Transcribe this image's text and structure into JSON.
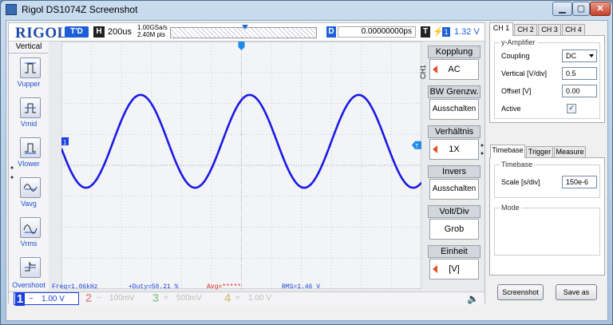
{
  "window": {
    "title": "Rigol DS1074Z Screenshot",
    "min_icon": "minimize-icon",
    "max_icon": "maximize-icon",
    "close_icon": "close-icon",
    "close_glyph": "✕"
  },
  "topbar": {
    "logo": "RIGOL",
    "mode_badge": "T'D",
    "timebase_badge": "H",
    "timebase": "200us",
    "sample_rate": "1.00GSa/s",
    "mem_depth": "2.40M pts",
    "delay_badge": "D",
    "delay": "0.00000000ps",
    "trigger_badge": "T",
    "trigger_slope_glyph": "⚡",
    "trigger_channel": "1",
    "trigger_level": "1.32 V"
  },
  "vertical": {
    "title": "Vertical",
    "buttons": [
      {
        "label": "Vupper",
        "icon": "vupper-icon"
      },
      {
        "label": "Vmid",
        "icon": "vmid-icon"
      },
      {
        "label": "Vlower",
        "icon": "vlower-icon"
      },
      {
        "label": "Vavg",
        "icon": "vavg-icon"
      },
      {
        "label": "Vrms",
        "icon": "vrms-icon"
      },
      {
        "label": "Overshoot",
        "icon": "overshoot-icon"
      }
    ]
  },
  "waveform": {
    "channel_color": "#1a1ae6",
    "cycles": 3.3,
    "amplitude_div": 1.5,
    "marker_ch": "1",
    "trigger_marker": "T"
  },
  "measurements": {
    "freq": "Freq=1.06kHz",
    "duty": "+Duty=50.21 %",
    "avg": "Avg=*****",
    "rms": "RMS=1.46 V"
  },
  "menu": {
    "channel_label": "CH1",
    "items": [
      {
        "title": "Kopplung",
        "value": "AC",
        "arrow": true
      },
      {
        "title": "BW Grenzw.",
        "value": "Ausschalten",
        "arrow": false
      },
      {
        "title": "Verhältnis",
        "value": "1X",
        "arrow": true
      },
      {
        "title": "Invers",
        "value": "Ausschalten",
        "arrow": false
      },
      {
        "title": "Volt/Div",
        "value": "Grob",
        "arrow": false
      },
      {
        "title": "Einheit",
        "value": "[V]",
        "arrow": true
      }
    ]
  },
  "channels": [
    {
      "num": "1",
      "coupling": "~",
      "scale": "1.00 V",
      "color": "#1a3fe0",
      "active": true
    },
    {
      "num": "2",
      "coupling": "~",
      "scale": "100mV",
      "color": "#e09a9a",
      "active": false
    },
    {
      "num": "3",
      "coupling": "=",
      "scale": "500mV",
      "color": "#9ad09a",
      "active": false
    },
    {
      "num": "4",
      "coupling": "=",
      "scale": "1.00 V",
      "color": "#d8c898",
      "active": false
    }
  ],
  "speaker_icon": "speaker-icon",
  "speaker_glyph": "🔈",
  "channel_tabs": [
    "CH 1",
    "CH 2",
    "CH 3",
    "CH 4"
  ],
  "y_amplifier": {
    "group": "y-Amplifier",
    "coupling_label": "Coupling",
    "coupling_value": "DC",
    "vertical_label": "Vertical [V/div]",
    "vertical_value": "0.5",
    "offset_label": "Offset [V]",
    "offset_value": "0.00",
    "active_label": "Active",
    "active_checked": "✓"
  },
  "time_tabs": [
    "Timebase",
    "Trigger",
    "Measure"
  ],
  "timebase_panel": {
    "group": "Timebase",
    "scale_label": "Scale [s/div]",
    "scale_value": "150e-6",
    "mode_group": "Mode"
  },
  "buttons": {
    "screenshot": "Screenshot",
    "save_as": "Save as"
  }
}
